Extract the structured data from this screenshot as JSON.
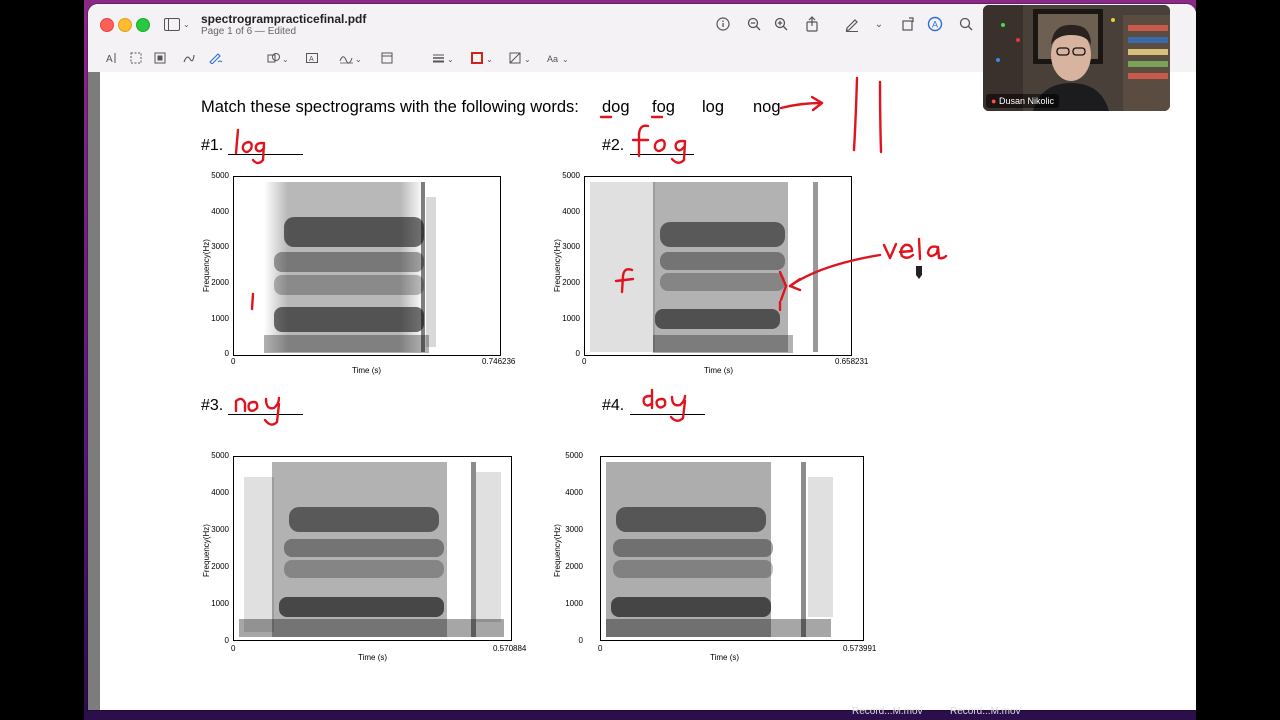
{
  "window": {
    "filename": "spectrogrampracticefinal.pdf",
    "subtitle": "Page 1 of 6 — Edited"
  },
  "toolbar": {
    "icons": [
      "info-icon",
      "zoom-out-icon",
      "zoom-in-icon",
      "share-icon",
      "markup-pen-icon",
      "chevron-down-icon",
      "rotate-icon",
      "markup-circle-icon",
      "search-icon"
    ]
  },
  "document": {
    "instruction": "Match these spectrograms with the following words:",
    "words": [
      "dog",
      "fog",
      "log",
      "nog"
    ],
    "items": [
      {
        "label": "#1.",
        "answer": "log",
        "xmax": "0.746236"
      },
      {
        "label": "#2.",
        "answer": "fog",
        "xmax": "0.658231"
      },
      {
        "label": "#3.",
        "answer": "noy",
        "xmax": "0.570884"
      },
      {
        "label": "#4.",
        "answer": "doy",
        "xmax": "0.573991"
      }
    ],
    "axis": {
      "ylabel": "Frequency(Hz)",
      "xlabel": "Time (s)",
      "xmin": "0",
      "yticks": [
        "5000",
        "4000",
        "3000",
        "2000",
        "1000",
        "0"
      ]
    },
    "annotations": {
      "fog_note": "vela",
      "f_mark": "f",
      "l_mark": "l"
    }
  },
  "webcam": {
    "name": "Dusan Nikolic"
  },
  "dock": {
    "items": [
      "Record...M.mov",
      "Record...M.mov"
    ]
  },
  "colors": {
    "ink": "#e0141e",
    "window_bg": "#f4f2f4"
  }
}
